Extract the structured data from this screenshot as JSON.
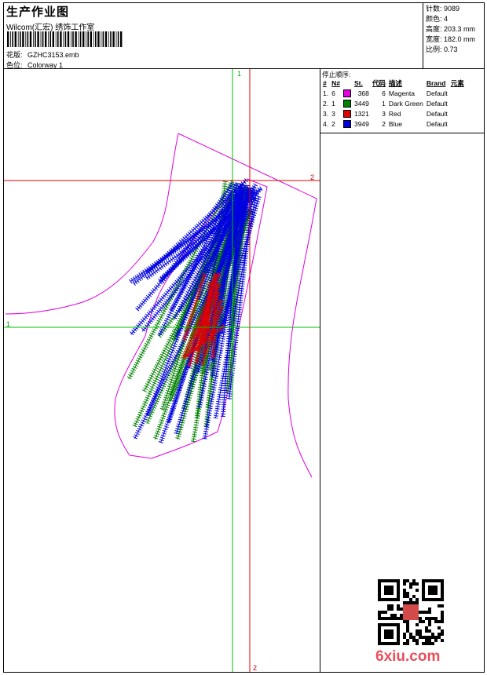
{
  "header": {
    "title": "生产作业图",
    "company": "Wilcom(汇宏) 绣饰工作室",
    "design_label": "花版:",
    "design_value": "GZHC3153.emb",
    "colorway_label": "色位:",
    "colorway_value": "Colorway 1"
  },
  "stats": [
    {
      "label": "针数:",
      "value": "9089"
    },
    {
      "label": "颜色:",
      "value": "4"
    },
    {
      "label": "高度:",
      "value": "203.3 mm"
    },
    {
      "label": "宽度:",
      "value": "182.0 mm"
    },
    {
      "label": "比例:",
      "value": "0.73"
    }
  ],
  "stop_sequence": {
    "title": "停止顺序:",
    "columns": [
      "#",
      "N#",
      "St.",
      "代码",
      "描述",
      "Brand",
      "元素"
    ],
    "rows": [
      {
        "idx": "1.",
        "n": "6",
        "color": "#e000e0",
        "st": "368",
        "code": "6",
        "desc": "Magenta",
        "brand": "Default"
      },
      {
        "idx": "2.",
        "n": "1",
        "color": "#008000",
        "st": "3449",
        "code": "1",
        "desc": "Dark Green",
        "brand": "Default"
      },
      {
        "idx": "3.",
        "n": "3",
        "color": "#e00000",
        "st": "1321",
        "code": "3",
        "desc": "Red",
        "brand": "Default"
      },
      {
        "idx": "4.",
        "n": "2",
        "color": "#0000e0",
        "st": "3949",
        "code": "2",
        "desc": "Blue",
        "brand": "Default"
      }
    ]
  },
  "axes": {
    "green_label": "1",
    "red_label": "2"
  },
  "watermark": "6xiu.com"
}
